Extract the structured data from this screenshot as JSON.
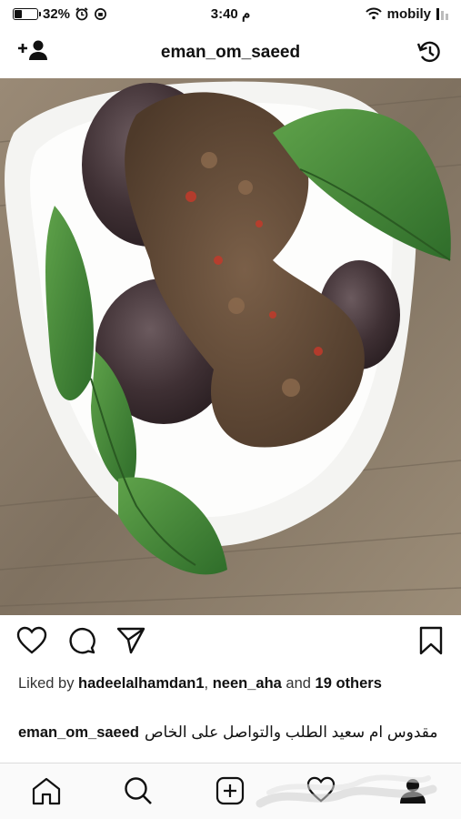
{
  "status_bar": {
    "battery_percent": "32%",
    "battery_level": 0.32,
    "time": "3:40 م",
    "carrier": "mobily"
  },
  "header": {
    "username": "eman_om_saeed"
  },
  "post": {
    "likes_prefix": "Liked by ",
    "liker_1": "hadeelalhamdan1",
    "separator": ", ",
    "liker_2": "neen_aha",
    "likes_and": " and ",
    "likes_others": "19 others",
    "caption_user": "eman_om_saeed",
    "caption_text": "مقدوس ام سعيد الطلب والتواصل على الخاص"
  },
  "icons": {
    "add_user": "add-user-icon",
    "history": "history-icon",
    "like": "heart-icon",
    "comment": "comment-icon",
    "share": "send-icon",
    "save": "bookmark-icon",
    "home": "home-icon",
    "search": "search-icon",
    "new_post": "plus-square-icon",
    "activity": "heart-icon",
    "profile": "profile-icon"
  },
  "colors": {
    "text": "#111111",
    "secondary_text": "#333333",
    "divider": "#dcdcdc"
  }
}
